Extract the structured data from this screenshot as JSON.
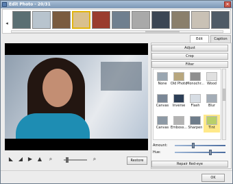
{
  "window": {
    "title": "Edit Photo - 20/31",
    "close_glyph": "✕"
  },
  "filmstrip": {
    "left_arrow": "◂",
    "right_arrow": "▸",
    "thumbnails": [
      {
        "color": "#5a6f73"
      },
      {
        "color": "#b8c4ce"
      },
      {
        "color": "#7a5b3f"
      },
      {
        "color": "#d9c08e",
        "selected": true
      },
      {
        "color": "#9a3c2e"
      },
      {
        "color": "#6f7f8f"
      },
      {
        "color": "#a9a9a9"
      },
      {
        "color": "#3b4654"
      },
      {
        "color": "#8a7f6c"
      },
      {
        "color": "#c9c1b5"
      },
      {
        "color": "#4e5a66"
      }
    ]
  },
  "tabs": {
    "edit": "Edit",
    "caption": "Caption"
  },
  "sections": {
    "adjust": "Adjust",
    "crop": "Crop",
    "filter": "Filter",
    "redeye": "Repair Red-eye"
  },
  "filters": [
    {
      "label": "None",
      "color": "#9aa6b1"
    },
    {
      "label": "Old Photo",
      "color": "#b8a77e"
    },
    {
      "label": "Monochr...",
      "color": "#8f8f8f"
    },
    {
      "label": "Wood",
      "color": "#e0e0e0"
    },
    {
      "label": "Canvas",
      "color": "#7a8796"
    },
    {
      "label": "Inverse",
      "color": "#2d3f57"
    },
    {
      "label": "Flash",
      "color": "#d7dde4"
    },
    {
      "label": "Blur",
      "color": "#a4adb7"
    },
    {
      "label": "Canvas",
      "color": "#8d99a5"
    },
    {
      "label": "Emboss...",
      "color": "#b3b3b3"
    },
    {
      "label": "Sharpen",
      "color": "#6e7c8a"
    },
    {
      "label": "Tint",
      "color": "#b9cf6a",
      "selected": true
    }
  ],
  "sliders": {
    "amount": {
      "label": "Amount:",
      "value": 0.35
    },
    "hue": {
      "label": "Hue:",
      "value": 0.72
    }
  },
  "toolbar": {
    "icons": [
      "rotate-left-icon",
      "rotate-right-icon",
      "flip-horizontal-icon",
      "flip-vertical-icon",
      "zoom-out-icon",
      "zoom-in-icon"
    ],
    "zoom_value": 0.1,
    "restore_label": "Restore"
  },
  "ok_label": "OK"
}
